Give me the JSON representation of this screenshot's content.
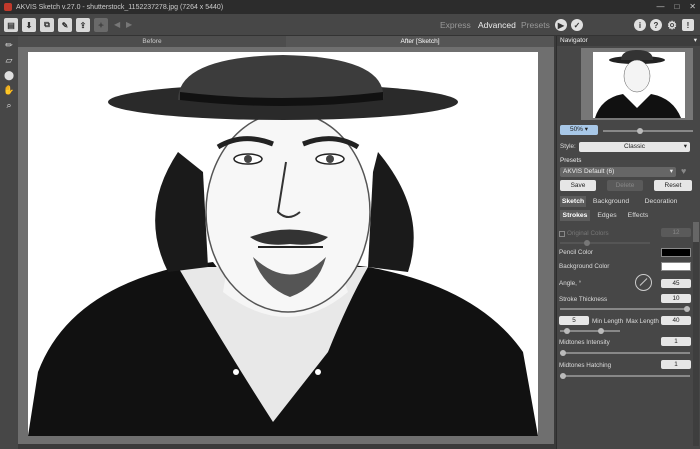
{
  "app": {
    "title": "AKVIS Sketch v.27.0 - shutterstock_1152237278.jpg (7264 x 5440)"
  },
  "window_controls": {
    "minimize": "—",
    "maximize": "□",
    "close": "✕"
  },
  "toolbar": {
    "icons": [
      "open-icon",
      "save-icon",
      "batch-icon",
      "preferences-icon",
      "share-icon",
      "plugin-icon",
      "undo-icon",
      "redo-icon"
    ],
    "modes": {
      "express": "Express",
      "advanced": "Advanced",
      "presets": "Presets"
    },
    "right_icons": [
      "info-icon",
      "help-icon",
      "settings-icon",
      "news-icon"
    ]
  },
  "left_tools": [
    "pencil-icon",
    "eraser-icon",
    "stamp-icon",
    "hand-icon",
    "zoom-icon"
  ],
  "view_tabs": {
    "before": "Before",
    "after": "After [Sketch]"
  },
  "navigator": {
    "title": "Navigator",
    "zoom": "50%"
  },
  "style": {
    "label": "Style:",
    "value": "Classic"
  },
  "presets": {
    "label": "Presets",
    "value": "AKVIS Default (6)",
    "save": "Save",
    "delete": "Delete",
    "reset": "Reset"
  },
  "main_tabs": {
    "sketch": "Sketch",
    "background": "Background",
    "decoration": "Decoration"
  },
  "sub_tabs": {
    "strokes": "Strokes",
    "edges": "Edges",
    "effects": "Effects"
  },
  "params": {
    "original_colors": {
      "label": "Original Colors",
      "value": "12"
    },
    "pencil_color": {
      "label": "Pencil Color",
      "color": "#000000"
    },
    "background_color": {
      "label": "Background Color",
      "color": "#ffffff"
    },
    "angle": {
      "label": "Angle, °",
      "value": "45"
    },
    "stroke_thickness": {
      "label": "Stroke Thickness",
      "value": "10",
      "level": 1.0
    },
    "min_length": {
      "label": "Min Length",
      "value": "5"
    },
    "max_length": {
      "label": "Max Length",
      "value": "40"
    },
    "midtones_intensity": {
      "label": "Midtones Intensity",
      "value": "1",
      "level": 0.01
    },
    "midtones_hatching": {
      "label": "Midtones Hatching",
      "value": "1",
      "level": 0.01
    }
  }
}
